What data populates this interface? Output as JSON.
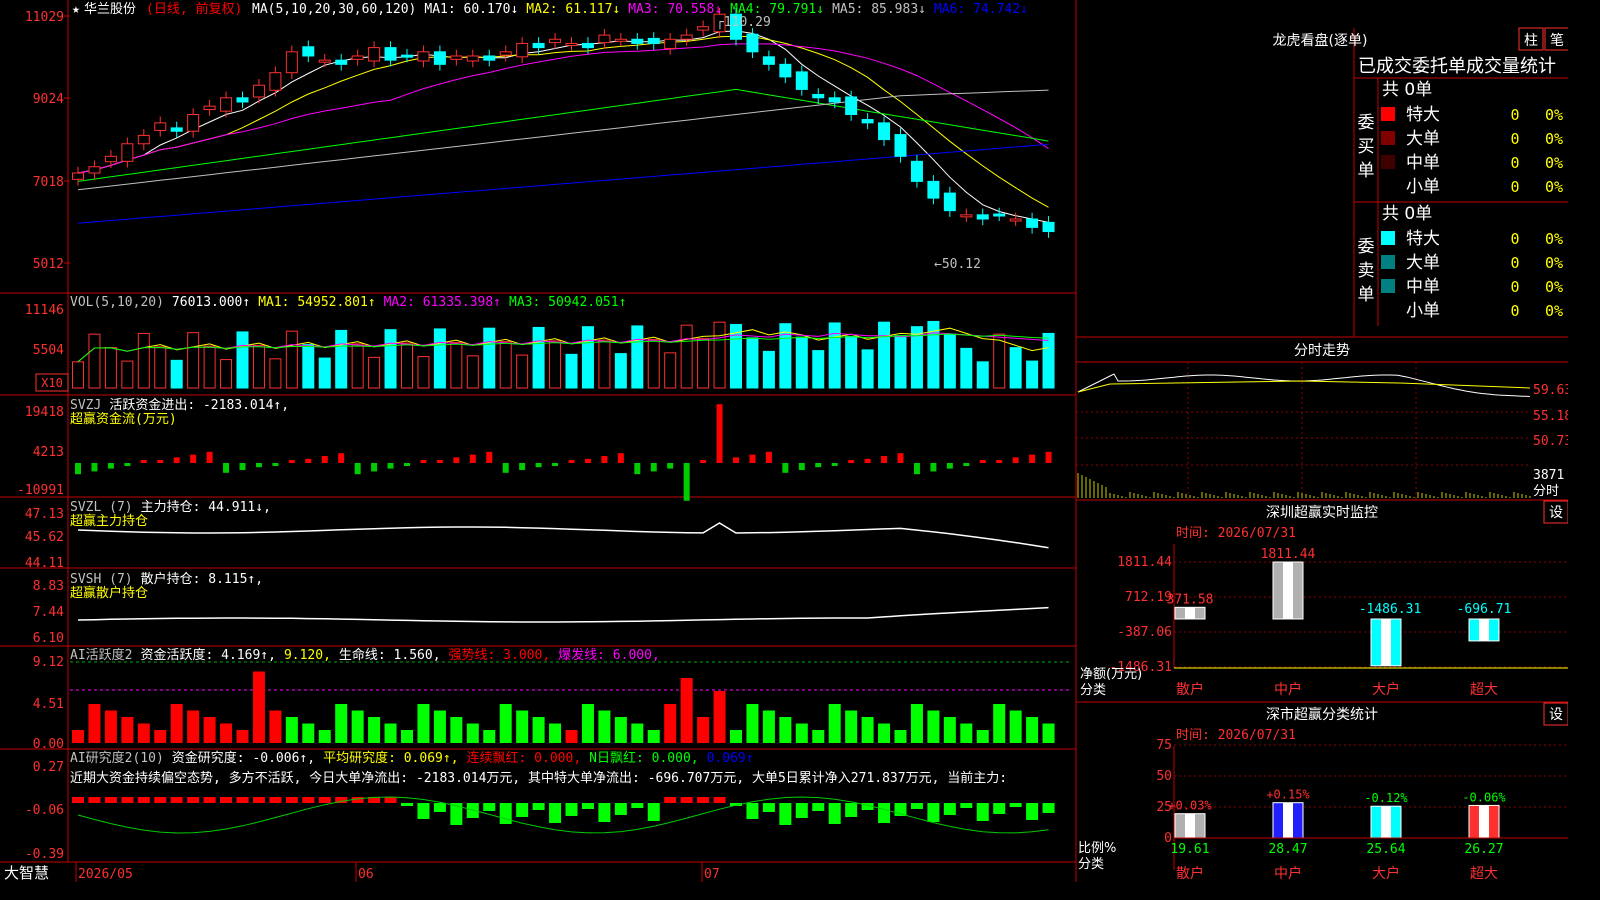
{
  "app": {
    "brand": "大智慧",
    "stock_name": "华兰股份",
    "period": "(日线, 前复权)",
    "star": "★"
  },
  "time_axis": [
    "2026/05",
    "06",
    "07"
  ],
  "main": {
    "ma_line": [
      {
        "t": "MA(5,10,20,30,60,120)",
        "c": "#ffffff"
      },
      {
        "t": "MA1: 60.170↓",
        "c": "#ffffff"
      },
      {
        "t": "MA2: 61.117↓",
        "c": "#ffff00"
      },
      {
        "t": "MA3: 70.558↓",
        "c": "#ff00ff"
      },
      {
        "t": "MA4: 79.791↓",
        "c": "#00ff00"
      },
      {
        "t": "MA5: 85.983↓",
        "c": "#c0c0c0"
      },
      {
        "t": "MA6: 74.742↓",
        "c": "#0000ff"
      }
    ],
    "yticks": [
      "11029",
      "9024",
      "7018",
      "5012"
    ],
    "high_label": "110.29",
    "low_label": "←50.12"
  },
  "vol": {
    "line": [
      {
        "t": "VOL(5,10,20)",
        "c": "#c0c0c0"
      },
      {
        "t": "76013.000↑",
        "c": "#ffffff"
      },
      {
        "t": "MA1: 54952.801↑",
        "c": "#ffff00"
      },
      {
        "t": "MA2: 61335.398↑",
        "c": "#ff00ff"
      },
      {
        "t": "MA3: 50942.051↑",
        "c": "#00ff00"
      }
    ],
    "yticks": [
      "11146",
      "5504"
    ],
    "unit": "X10"
  },
  "svzj": {
    "line": [
      {
        "t": "SVZJ",
        "c": "#c0c0c0"
      },
      {
        "t": "活跃资金进出: -2183.014↑,",
        "c": "#ffffff"
      }
    ],
    "sub": "超赢资金流(万元)",
    "yticks": [
      "19418",
      "4213",
      "-10991"
    ]
  },
  "svzl": {
    "line": [
      {
        "t": "SVZL (7)",
        "c": "#c0c0c0"
      },
      {
        "t": "主力持仓: 44.911↓,",
        "c": "#ffffff"
      }
    ],
    "sub": "超赢主力持仓",
    "yticks": [
      "47.13",
      "45.62",
      "44.11"
    ]
  },
  "svsh": {
    "line": [
      {
        "t": "SVSH (7)",
        "c": "#c0c0c0"
      },
      {
        "t": "散户持仓: 8.115↑,",
        "c": "#ffffff"
      }
    ],
    "sub": "超赢散户持仓",
    "yticks": [
      "8.83",
      "7.44",
      "6.10"
    ]
  },
  "ai1": {
    "line": [
      {
        "t": "AI活跃度2",
        "c": "#c0c0c0"
      },
      {
        "t": "资金活跃度: 4.169↑,",
        "c": "#ffffff"
      },
      {
        "t": "9.120,",
        "c": "#ffff00"
      },
      {
        "t": "生命线: 1.560,",
        "c": "#ffffff"
      },
      {
        "t": "强势线: 3.000,",
        "c": "#ff0000"
      },
      {
        "t": "爆发线: 6.000,",
        "c": "#ff00ff"
      }
    ],
    "yticks": [
      "9.12",
      "4.51",
      "0.00"
    ]
  },
  "ai2": {
    "line": [
      {
        "t": "AI研究度2(10)",
        "c": "#c0c0c0"
      },
      {
        "t": "资金研究度: -0.006↑,",
        "c": "#ffffff"
      },
      {
        "t": "平均研究度: 0.069↑,",
        "c": "#ffff00"
      },
      {
        "t": "连续飘红: 0.000,",
        "c": "#ff0000"
      },
      {
        "t": "N日飘红: 0.000,",
        "c": "#00ff00"
      },
      {
        "t": "0.069↑",
        "c": "#0000ff"
      }
    ],
    "text": "近期大资金持续偏空态势, 多方不活跃, 今日大单净流出: -2183.014万元, 其中特大单净流出: -696.707万元, 大单5日累计净入271.837万元, 当前主力:",
    "yticks": [
      "0.27",
      "-0.06",
      "-0.39"
    ]
  },
  "lhkp": {
    "title": "龙虎看盘(逐单)",
    "btn1": "柱",
    "btn2": "笔",
    "subtitle": "已成交委托单成交量统计",
    "buy": {
      "side": "委买单",
      "total": "共 0单",
      "rows": [
        {
          "l": "特大",
          "v": "0",
          "p": "0%",
          "c": "#ff0000"
        },
        {
          "l": "大单",
          "v": "0",
          "p": "0%",
          "c": "#800000"
        },
        {
          "l": "中单",
          "v": "0",
          "p": "0%",
          "c": "#400000"
        },
        {
          "l": "小单",
          "v": "0",
          "p": "0%",
          "c": ""
        }
      ]
    },
    "sell": {
      "side": "委卖单",
      "total": "共 0单",
      "rows": [
        {
          "l": "特大",
          "v": "0",
          "p": "0%",
          "c": "#00ffff"
        },
        {
          "l": "大单",
          "v": "0",
          "p": "0%",
          "c": "#008080"
        },
        {
          "l": "中单",
          "v": "0",
          "p": "0%",
          "c": "#008080"
        },
        {
          "l": "小单",
          "v": "0",
          "p": "0%",
          "c": ""
        }
      ]
    }
  },
  "fenshi": {
    "title": "分时走势",
    "yticks": [
      "59.63",
      "55.18",
      "50.73",
      "3871"
    ],
    "unit": "分时"
  },
  "szjk": {
    "title": "深圳超赢实时监控",
    "setting": "设",
    "time": "时间: 2026/07/31",
    "yticks": [
      "1811.44",
      "712.19",
      "-387.06",
      "-1486.31"
    ],
    "ylabel": "净额(万元)",
    "xlabel": "分类",
    "cats": [
      "散户",
      "中户",
      "大户",
      "超大"
    ]
  },
  "szfl": {
    "title": "深市超赢分类统计",
    "setting": "设",
    "time": "时间: 2026/07/31",
    "yticks": [
      "75",
      "50",
      "25",
      "0"
    ],
    "ylabel": "比例%",
    "xlabel": "分类",
    "cats": [
      "散户",
      "中户",
      "大户",
      "超大"
    ]
  },
  "chart_data": [
    {
      "type": "bar",
      "title": "深圳超赢实时监控",
      "categories": [
        "散户",
        "中户",
        "大户",
        "超大"
      ],
      "values": [
        371.58,
        1811.44,
        -1486.31,
        -696.71
      ],
      "ylim": [
        -1486.31,
        1811.44
      ],
      "ylabel": "净额(万元)"
    },
    {
      "type": "bar",
      "title": "深市超赢分类统计",
      "categories": [
        "散户",
        "中户",
        "大户",
        "超大"
      ],
      "values": [
        19.61,
        28.47,
        25.64,
        26.27
      ],
      "changes": [
        "+0.03%",
        "+0.15%",
        "-0.12%",
        "-0.06%"
      ],
      "ylim": [
        0,
        75
      ],
      "ylabel": "比例%"
    }
  ]
}
